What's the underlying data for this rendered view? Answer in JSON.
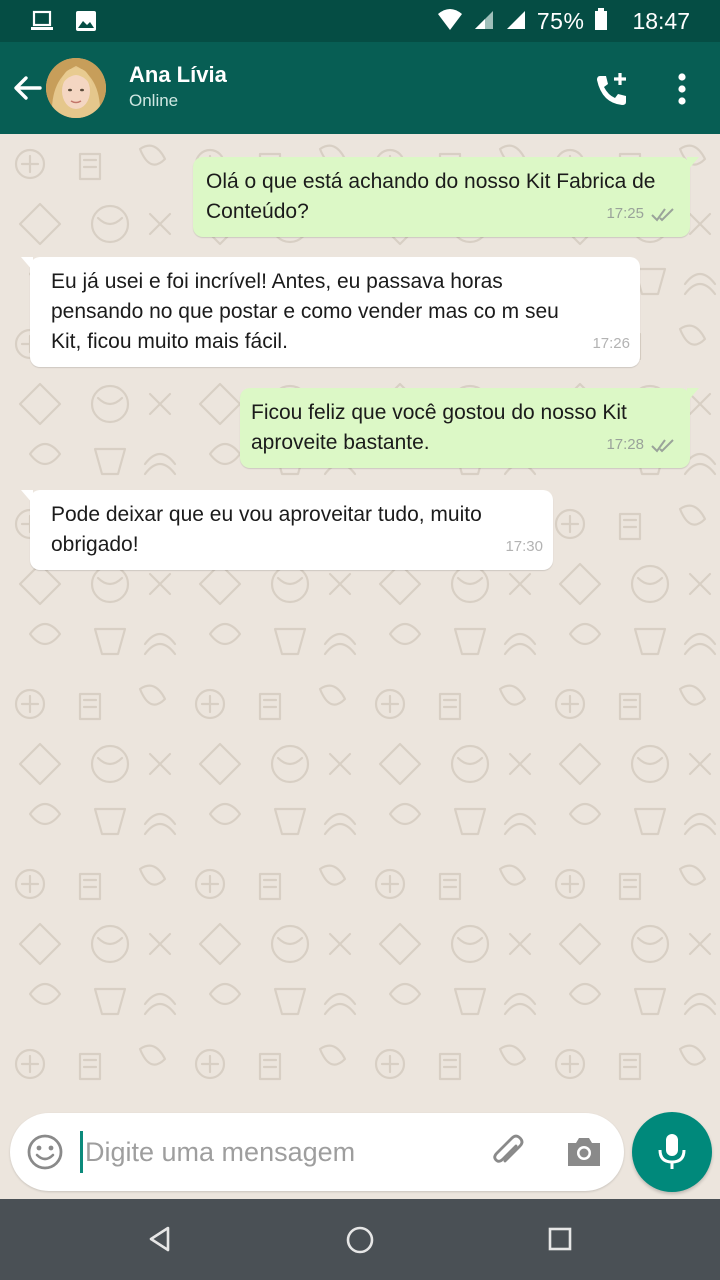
{
  "status_bar": {
    "battery": "75%",
    "time": "18:47",
    "icons": [
      "laptop-icon",
      "image-icon",
      "wifi-icon",
      "signal-icon",
      "signal-icon",
      "battery-icon"
    ]
  },
  "header": {
    "contact_name": "Ana Lívia",
    "contact_status": "Online",
    "icons": [
      "back-arrow-icon",
      "avatar",
      "add-call-icon",
      "more-vert-icon"
    ]
  },
  "messages": [
    {
      "direction": "out",
      "text": "Olá o que está achando do nosso Kit Fabrica de Conteúdo?",
      "time": "17:25",
      "status": "read"
    },
    {
      "direction": "in",
      "text": "Eu já usei e foi incrível! Antes, eu passava horas pensando no que postar e como vender mas co m seu Kit, ficou muito mais fácil.",
      "time": "17:26"
    },
    {
      "direction": "out",
      "text": "Ficou feliz que você gostou do nosso Kit aproveite bastante.",
      "time": "17:28",
      "status": "read"
    },
    {
      "direction": "in",
      "text": "Pode deixar que eu vou aproveitar tudo, muito obrigado!",
      "time": "17:30"
    }
  ],
  "composer": {
    "placeholder": "Digite uma mensagem",
    "icons": [
      "emoji-icon",
      "attach-icon",
      "camera-icon",
      "mic-icon"
    ]
  },
  "colors": {
    "header": "#075e54",
    "status_bar": "#054d44",
    "outgoing_bubble": "#dcf8c6",
    "incoming_bubble": "#ffffff",
    "chat_background": "#ece5dd",
    "fab": "#00897b",
    "read_ticks": "#9aa39a",
    "nav_bar": "#4a5055"
  }
}
